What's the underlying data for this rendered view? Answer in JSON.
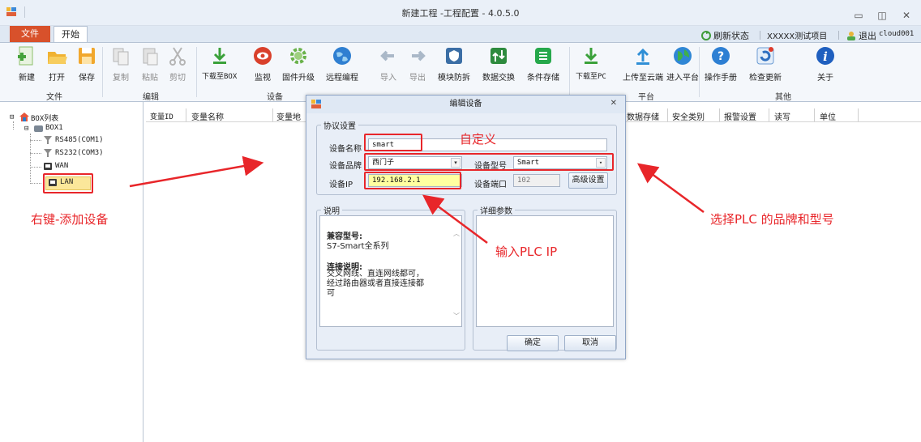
{
  "window": {
    "title": "新建工程 -工程配置 - 4.0.5.0"
  },
  "ribbon_tabs": {
    "file": "文件",
    "start": "开始"
  },
  "ribbon_right": {
    "refresh": "刷新状态",
    "project": "XXXXX测试项目",
    "logout": "退出",
    "user": "cloud001"
  },
  "ribbon_buttons": [
    {
      "label": "新建",
      "icon": "new-file-icon"
    },
    {
      "label": "打开",
      "icon": "open-folder-icon"
    },
    {
      "label": "保存",
      "icon": "save-icon"
    },
    {
      "label": "复制",
      "icon": "copy-icon"
    },
    {
      "label": "粘贴",
      "icon": "paste-icon"
    },
    {
      "label": "剪切",
      "icon": "cut-icon"
    },
    {
      "label": "下载至BOX",
      "icon": "download-icon"
    },
    {
      "label": "监视",
      "icon": "monitor-eye-icon"
    },
    {
      "label": "固件升级",
      "icon": "gear-icon"
    },
    {
      "label": "远程编程",
      "icon": "globe-icon"
    },
    {
      "label": "导入",
      "icon": "import-arrow-icon"
    },
    {
      "label": "导出",
      "icon": "export-arrow-icon"
    },
    {
      "label": "模块防拆",
      "icon": "shield-icon"
    },
    {
      "label": "数据交换",
      "icon": "exchange-icon"
    },
    {
      "label": "条件存储",
      "icon": "list-icon"
    },
    {
      "label": "下载至PC",
      "icon": "download-pc-icon"
    },
    {
      "label": "上传至云端",
      "icon": "upload-cloud-icon"
    },
    {
      "label": "进入平台",
      "icon": "earth-icon"
    },
    {
      "label": "操作手册",
      "icon": "help-icon"
    },
    {
      "label": "检查更新",
      "icon": "refresh-icon"
    },
    {
      "label": "关于",
      "icon": "info-icon"
    }
  ],
  "ribbon_groups": {
    "file": "文件",
    "edit": "编辑",
    "device": "设备",
    "platform": "平台",
    "other": "其他"
  },
  "tree": {
    "root": "BOX列表",
    "box": "BOX1",
    "items": [
      "RS485(COM1)",
      "RS232(COM3)",
      "WAN",
      "LAN"
    ]
  },
  "grid": {
    "columns": [
      "变量ID",
      "变量名称",
      "变量地",
      "数据存储",
      "安全类别",
      "报警设置",
      "读写",
      "单位"
    ]
  },
  "dialog": {
    "title": "编辑设备",
    "protocol_group": "协议设置",
    "name_label": "设备名称",
    "name_value": "smart",
    "brand_label": "设备品牌",
    "brand_value": "西门子",
    "model_label": "设备型号",
    "model_value": "Smart",
    "ip_label": "设备IP",
    "ip_value": "192.168.2.1",
    "port_label": "设备端口",
    "port_value": "102",
    "advanced": "高级设置",
    "desc_group": "说明",
    "compat_title": "兼容型号:",
    "compat_text": "S7-Smart全系列",
    "conn_title": "连接说明:",
    "conn_lines": [
      "交叉网线、直连网线都可，",
      "经过路由器或者直接连接都",
      "可"
    ],
    "detail_group": "详细参数",
    "ok": "确定",
    "cancel": "取消"
  },
  "annotations": {
    "add_device": "右键-添加设备",
    "custom": "自定义",
    "choose_brand": "选择PLC 的品牌和型号",
    "enter_ip": "输入PLC IP"
  }
}
